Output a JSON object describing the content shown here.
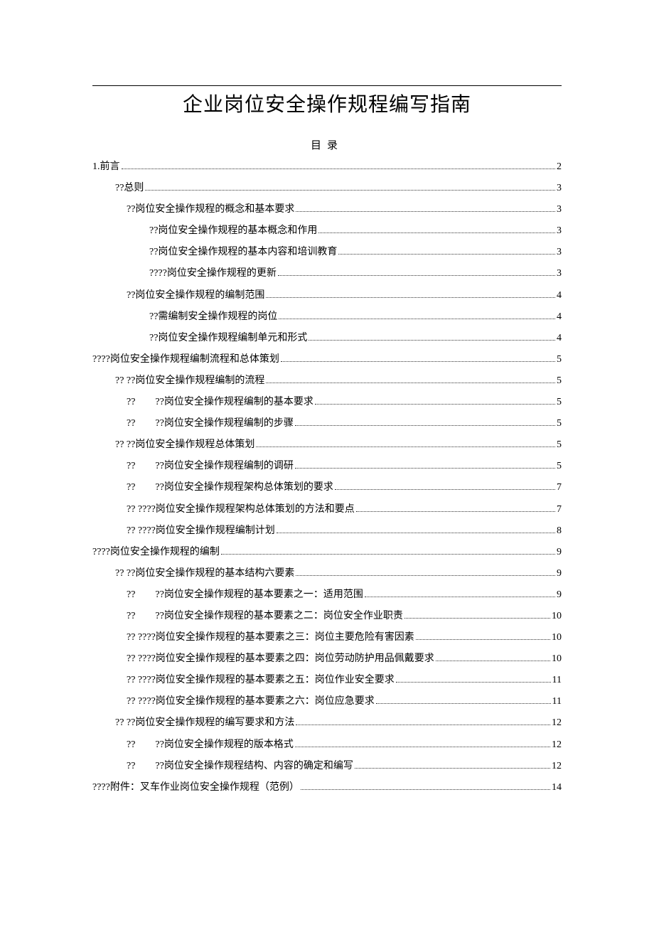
{
  "title": "企业岗位安全操作规程编写指南",
  "toc_heading": "目录",
  "toc": [
    {
      "indent": 0,
      "label": "1.前言",
      "page": "2"
    },
    {
      "indent": 1,
      "label": "??总则",
      "page": "3"
    },
    {
      "indent": 2,
      "label": "??岗位安全操作规程的概念和基本要求",
      "page": "3"
    },
    {
      "indent": 3,
      "label": "??岗位安全操作规程的基本概念和作用",
      "page": "3"
    },
    {
      "indent": 3,
      "label": "??岗位安全操作规程的基本内容和培训教育",
      "page": "3"
    },
    {
      "indent": 3,
      "label": "????岗位安全操作规程的更新",
      "page": "3"
    },
    {
      "indent": 2,
      "label": "??岗位安全操作规程的编制范围",
      "page": "4"
    },
    {
      "indent": 3,
      "label": "??需编制安全操作规程的岗位",
      "page": "4"
    },
    {
      "indent": 3,
      "label": "??岗位安全操作规程编制单元和形式",
      "page": "4"
    },
    {
      "indent": 0,
      "label": "????岗位安全操作规程编制流程和总体策划",
      "page": "5"
    },
    {
      "indent": 1,
      "label": "?? ??岗位安全操作规程编制的流程",
      "page": "5"
    },
    {
      "indent": 4,
      "label": "??　　??岗位安全操作规程编制的基本要求",
      "page": "5"
    },
    {
      "indent": 4,
      "label": "??　　??岗位安全操作规程编制的步骤",
      "page": "5"
    },
    {
      "indent": 1,
      "label": "?? ??岗位安全操作规程总体策划",
      "page": "5"
    },
    {
      "indent": 4,
      "label": "??　　??岗位安全操作规程编制的调研",
      "page": "5"
    },
    {
      "indent": 4,
      "label": "??　　??岗位安全操作规程架构总体策划的要求",
      "page": "7"
    },
    {
      "indent": 4,
      "label": "?? ????岗位安全操作规程架构总体策划的方法和要点",
      "page": "7"
    },
    {
      "indent": 4,
      "label": "?? ????岗位安全操作规程编制计划",
      "page": "8"
    },
    {
      "indent": 0,
      "label": "????岗位安全操作规程的编制",
      "page": "9"
    },
    {
      "indent": 1,
      "label": "?? ??岗位安全操作规程的基本结构六要素",
      "page": "9"
    },
    {
      "indent": 4,
      "label": "??　　??岗位安全操作规程的基本要素之一：适用范围",
      "page": "9"
    },
    {
      "indent": 4,
      "label": "??　　??岗位安全操作规程的基本要素之二：岗位安全作业职责",
      "page": "10"
    },
    {
      "indent": 4,
      "label": "?? ????岗位安全操作规程的基本要素之三：岗位主要危险有害因素",
      "page": "10"
    },
    {
      "indent": 4,
      "label": "?? ????岗位安全操作规程的基本要素之四：岗位劳动防护用品佩戴要求",
      "page": "10"
    },
    {
      "indent": 4,
      "label": "?? ????岗位安全操作规程的基本要素之五：岗位作业安全要求",
      "page": "11"
    },
    {
      "indent": 4,
      "label": "?? ????岗位安全操作规程的基本要素之六：岗位应急要求",
      "page": "11"
    },
    {
      "indent": 1,
      "label": "?? ??岗位安全操作规程的编写要求和方法",
      "page": "12"
    },
    {
      "indent": 4,
      "label": "??　　??岗位安全操作规程的版本格式",
      "page": "12"
    },
    {
      "indent": 4,
      "label": "??　　??岗位安全操作规程结构、内容的确定和编写",
      "page": "12"
    },
    {
      "indent": 0,
      "label": "????附件：叉车作业岗位安全操作规程（范例）",
      "page": "14"
    }
  ]
}
